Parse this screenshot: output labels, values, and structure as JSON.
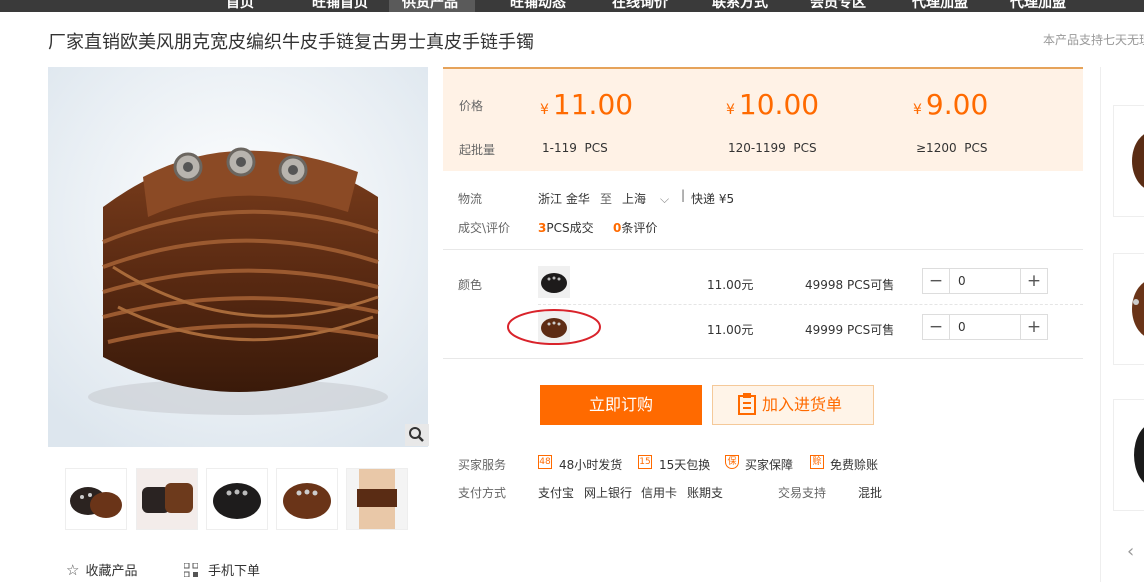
{
  "nav": {
    "items": [
      "首页",
      "旺铺首页",
      "供货产品",
      "旺铺动态",
      "在线询价",
      "联系方式",
      "会员专区",
      "代理加盟"
    ]
  },
  "product": {
    "title": "厂家直销欧美风朋克宽皮编织牛皮手链复古男士真皮手链手镯",
    "service_note": "本产品支持七天无理"
  },
  "pricing": {
    "price_label": "价格",
    "moq_label": "起批量",
    "currency": "¥",
    "tiers": [
      {
        "price": "11.00",
        "range": "1-119",
        "unit": "PCS"
      },
      {
        "price": "10.00",
        "range": "120-1199",
        "unit": "PCS"
      },
      {
        "price": "9.00",
        "range": "≥1200",
        "unit": "PCS"
      }
    ]
  },
  "logistics": {
    "label": "物流",
    "from": "浙江 金华",
    "to_word": "至",
    "to": "上海",
    "express": "快递 ¥5"
  },
  "deals": {
    "label": "成交\\评价",
    "sold_count": "3",
    "sold_text": "PCS成交",
    "review_count": "0",
    "review_text": "条评价"
  },
  "sku": {
    "label": "颜色",
    "rows": [
      {
        "price": "11.00元",
        "stock": "49998 PCS可售",
        "qty": "0"
      },
      {
        "price": "11.00元",
        "stock": "49999 PCS可售",
        "qty": "0"
      }
    ]
  },
  "actions": {
    "buy_label": "立即订购",
    "cart_label": "加入进货单"
  },
  "services": {
    "label": "买家服务",
    "items": [
      {
        "icon": "48",
        "text": "48小时发货"
      },
      {
        "icon": "15",
        "text": "15天包换"
      },
      {
        "icon": "保",
        "text": "买家保障"
      },
      {
        "icon": "赊",
        "text": "免费赊账"
      }
    ]
  },
  "payment": {
    "label": "支付方式",
    "methods": [
      "支付宝",
      "网上银行",
      "信用卡",
      "账期支"
    ],
    "trade_label": "交易支持",
    "trade_value": "混批"
  },
  "footer": {
    "favorite": "收藏产品",
    "mobile": "手机下单"
  },
  "colors": {
    "accent": "#ff6a00",
    "price_bg": "#fff2e6"
  }
}
